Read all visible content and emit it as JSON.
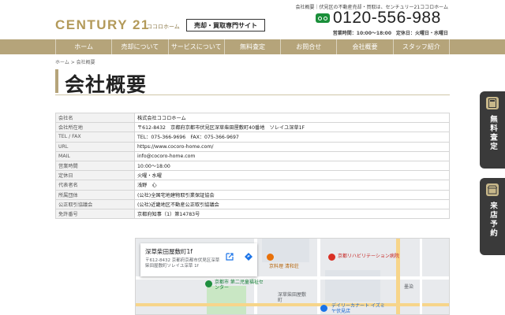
{
  "header": {
    "tagline": "会社概要｜伏見区の不動産売却・買取は、センチュリー21ココロホーム",
    "logo": "CENTURY 21",
    "logo_sub": "ココロホーム",
    "tag": "売却・買取専門サイト",
    "phone": "0120-556-988",
    "hours": "営業時間：10:00〜18:00　定休日：火曜日・水曜日"
  },
  "nav": [
    "ホーム",
    "売却について",
    "サービスについて",
    "無料査定",
    "お問合せ",
    "会社概要",
    "スタッフ紹介"
  ],
  "breadcrumb": "ホーム > 会社概要",
  "page_title": "会社概要",
  "company_table": [
    {
      "label": "会社名",
      "value": "株式会社ココロホーム"
    },
    {
      "label": "会社所在地",
      "value": "〒612-8432　京都府京都市伏見区深草柴田屋敷町40番地　ソレイユ深草1F"
    },
    {
      "label": "TEL / FAX",
      "value": "TEL：075-366-9696　FAX：075-366-9697"
    },
    {
      "label": "URL",
      "value": "https://www.cocoro-home.com/"
    },
    {
      "label": "MAIL",
      "value": "info@cocoro-home.com"
    },
    {
      "label": "営業時間",
      "value": "10:00〜18:00"
    },
    {
      "label": "定休日",
      "value": "火曜・水曜"
    },
    {
      "label": "代表者名",
      "value": "浅野　心"
    },
    {
      "label": "所属団体",
      "value": "(公社)全国宅地建物取引業保証協会"
    },
    {
      "label": "公正取引協議会",
      "value": "(公社)近畿地区不動産公正取引協議会"
    },
    {
      "label": "免許番号",
      "value": "京都府知事（1）第14783号"
    }
  ],
  "map": {
    "card_title": "深草柴田屋敷町1f",
    "card_address": "〒612-8432 京都府京都市伏見区深草柴田屋敷町ソレイユ深草 1f",
    "labels": {
      "cafe": "京料理 清和荘",
      "hospital": "京都リハビリテーション病院",
      "school": "京都市 第二児童福祉センター",
      "district": "深草柴田屋敷町",
      "store": "デイリーカナート イズミヤ伏見店",
      "area": "墨染"
    }
  },
  "side_buttons": {
    "assess": "無料査定",
    "visit": "来店予約"
  }
}
